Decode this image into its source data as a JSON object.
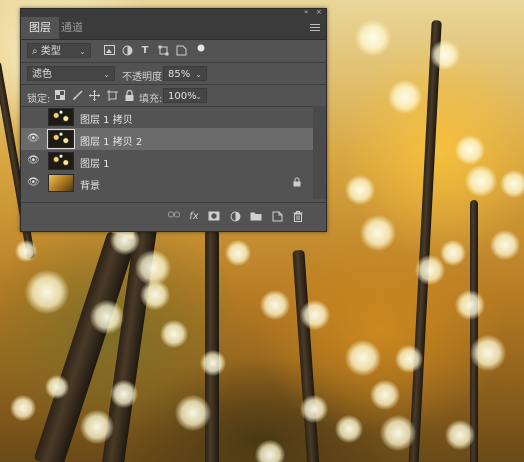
{
  "tabs": [
    {
      "label": "图层",
      "active": true
    },
    {
      "label": "通道",
      "active": false
    }
  ],
  "filter": {
    "kind_label": "类型",
    "search_glyph": "⌕"
  },
  "blend": {
    "mode": "滤色",
    "opacity_label": "不透明度:",
    "opacity_value": "85%"
  },
  "lock": {
    "label": "锁定:",
    "fill_label": "填充:",
    "fill_value": "100%"
  },
  "layers": [
    {
      "name": "图层 1 拷贝",
      "visible": false,
      "selected": false,
      "thumb": "bokeh"
    },
    {
      "name": "图层 1 拷贝 2",
      "visible": true,
      "selected": true,
      "thumb": "bokeh"
    },
    {
      "name": "图层 1",
      "visible": true,
      "selected": false,
      "thumb": "bokeh"
    },
    {
      "name": "背景",
      "visible": true,
      "selected": false,
      "thumb": "photo",
      "locked": true
    }
  ],
  "footer": {
    "fx_label": "fx"
  },
  "icons": {
    "eye": "👁",
    "lock": "🔒",
    "collapse": "«",
    "close": "×"
  },
  "colors": {
    "panel_bg": "#535353",
    "tab_bar": "#3b3b3b",
    "selected_row": "#6b6b6b"
  }
}
